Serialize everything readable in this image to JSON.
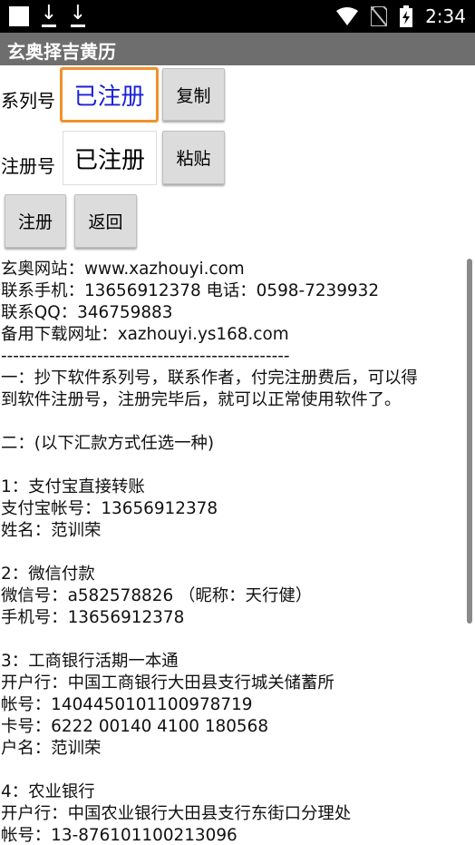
{
  "status_bar": {
    "time": "2:34",
    "icons": [
      "notification-square-icon",
      "download-icon",
      "download-icon",
      "wifi-icon",
      "no-sim-icon",
      "battery-charging-icon"
    ]
  },
  "app_bar": {
    "title": "玄奥择吉黄历"
  },
  "form": {
    "serial_label": "系列号",
    "serial_value": "已注册",
    "copy_button": "复制",
    "reg_label": "注册号",
    "reg_value": "已注册",
    "paste_button": "粘贴",
    "register_button": "注册",
    "back_button": "返回"
  },
  "info_lines": [
    "玄奥网站：www.xazhouyi.com",
    "联系手机：13656912378 电话：0598-7239932",
    "联系QQ：346759883",
    "备用下载网址：xazhouyi.ys168.com",
    "------------------------------------------------",
    "一：抄下软件系列号，联系作者，付完注册费后，可以得",
    "到软件注册号，注册完毕后，就可以正常使用软件了。",
    "",
    "二：(以下汇款方式任选一种)",
    "",
    "1：支付宝直接转账",
    "支付宝帐号：13656912378",
    "姓名：范训荣",
    "",
    "2：微信付款",
    "微信号：a582578826 （昵称：天行健）",
    "手机号：13656912378",
    "",
    "3：工商银行活期一本通",
    "开户行：中国工商银行大田县支行城关储蓄所",
    "帐号：1404450101100978719",
    "卡号：6222 00140 4100 180568",
    "户名：范训荣",
    "",
    "4：农业银行",
    "开户行：中国农业银行大田县支行东街口分理处",
    "帐号：13-876101100213096"
  ]
}
